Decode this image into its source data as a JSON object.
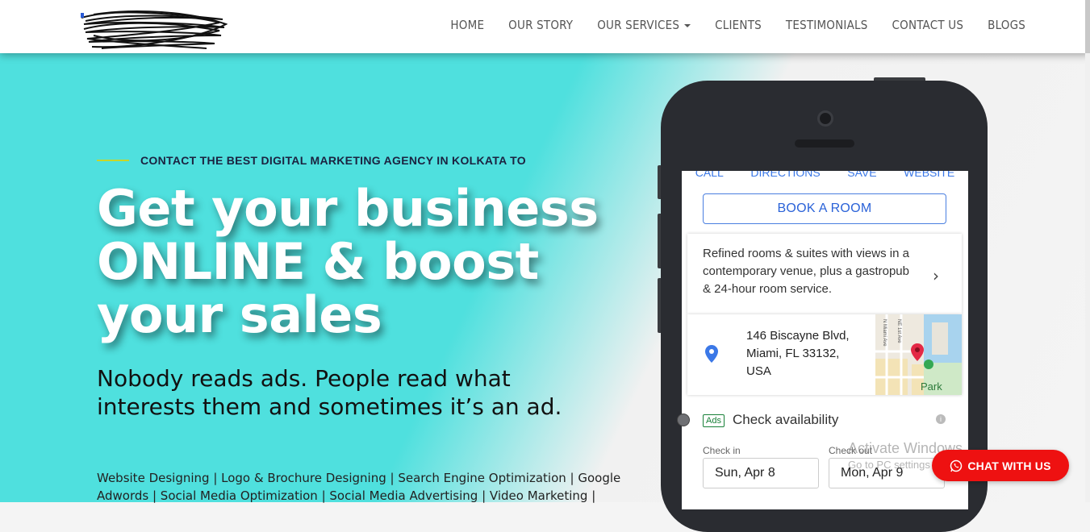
{
  "nav": {
    "items": [
      {
        "label": "HOME"
      },
      {
        "label": "OUR STORY"
      },
      {
        "label": "OUR SERVICES",
        "has_dropdown": true
      },
      {
        "label": "CLIENTS"
      },
      {
        "label": "TESTIMONIALS"
      },
      {
        "label": "CONTACT US"
      },
      {
        "label": "BLOGS"
      }
    ]
  },
  "hero": {
    "kicker": "CONTACT THE BEST DIGITAL MARKETING AGENCY IN KOLKATA TO",
    "headline": "Get your business ONLINE & boost your sales",
    "subheadline": "Nobody reads ads. People read what interests them and sometimes it’s an ad.",
    "services": "Website Designing | Logo & Brochure Designing | Search Engine Optimization | Google Adwords | Social Media Optimization | Social Media Advertising | Video Marketing |"
  },
  "phone": {
    "top_links": [
      "CALL",
      "DIRECTIONS",
      "SAVE",
      "WEBSITE"
    ],
    "book_button": "BOOK A ROOM",
    "description": "Refined rooms & suites with views in a contemporary venue, plus a gastropub & 24-hour room service.",
    "address": "146 Biscayne Blvd, Miami, FL 33132, USA",
    "map_labels": {
      "park": "Park",
      "street1": "N Miami Ave",
      "street2": "NE 1st Ave"
    },
    "ads_badge": "Ads",
    "check_title": "Check availability",
    "check_in_label": "Check in",
    "check_in_value": "Sun, Apr 8",
    "check_out_label": "Check out",
    "check_out_value": "Mon, Apr 9"
  },
  "watermark": {
    "line1": "Activate Windows",
    "line2": "Go to PC settings to activate Windows."
  },
  "chat_button": "CHAT WITH US",
  "colors": {
    "hero_teal": "#4fe0de",
    "accent_line": "#c7d62a",
    "chat_red": "#ee1111",
    "link_blue": "#2a62d8"
  }
}
